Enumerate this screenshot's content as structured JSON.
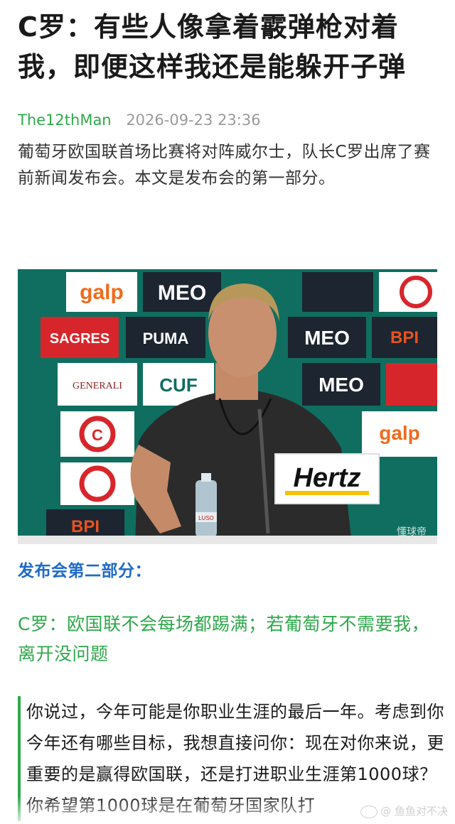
{
  "article": {
    "title": "C罗：有些人像拿着霰弹枪对着我，即便这样我还是能躲开子弹",
    "author": "The12thMan",
    "datetime": "2026-09-23 23:36",
    "intro": "葡萄牙欧国联首场比赛将对阵威尔士，队长C罗出席了赛前新闻发布会。本文是发布会的第一部分。",
    "section_heading": "发布会第二部分：",
    "subtitle": "C罗：欧国联不会每场都踢满；若葡萄牙不需要我，离开没问题",
    "quote": "你说过，今年可能是你职业生涯的最后一年。考虑到你今年还有哪些目标，我想直接问你：现在对你来说，更重要的是赢得欧国联，还是打进职业生涯第1000球？你希望第1000球是在葡萄牙国家队打"
  },
  "photo": {
    "sponsor_boards": [
      "galp",
      "MEO",
      "PUMA",
      "SAGRES",
      "BPI",
      "CUF",
      "GENERALI",
      "C"
    ],
    "microphone_sign": "Hertz",
    "photo_watermark": "懂球帝",
    "bottle_label": "LUSO",
    "colors": {
      "board_teal": "#0f6e60",
      "galp_orange": "#ef6b1d",
      "sagres_red": "#d7262b",
      "bpi_orange": "#e8521f",
      "hertz_yellow": "#f6c200"
    }
  },
  "watermark": {
    "text": "@ 鱼鱼对不决"
  },
  "colors": {
    "green": "#2ea84a",
    "blue": "#1e6ac8",
    "gray": "#9a9a9a",
    "text": "#1a1a1a"
  }
}
